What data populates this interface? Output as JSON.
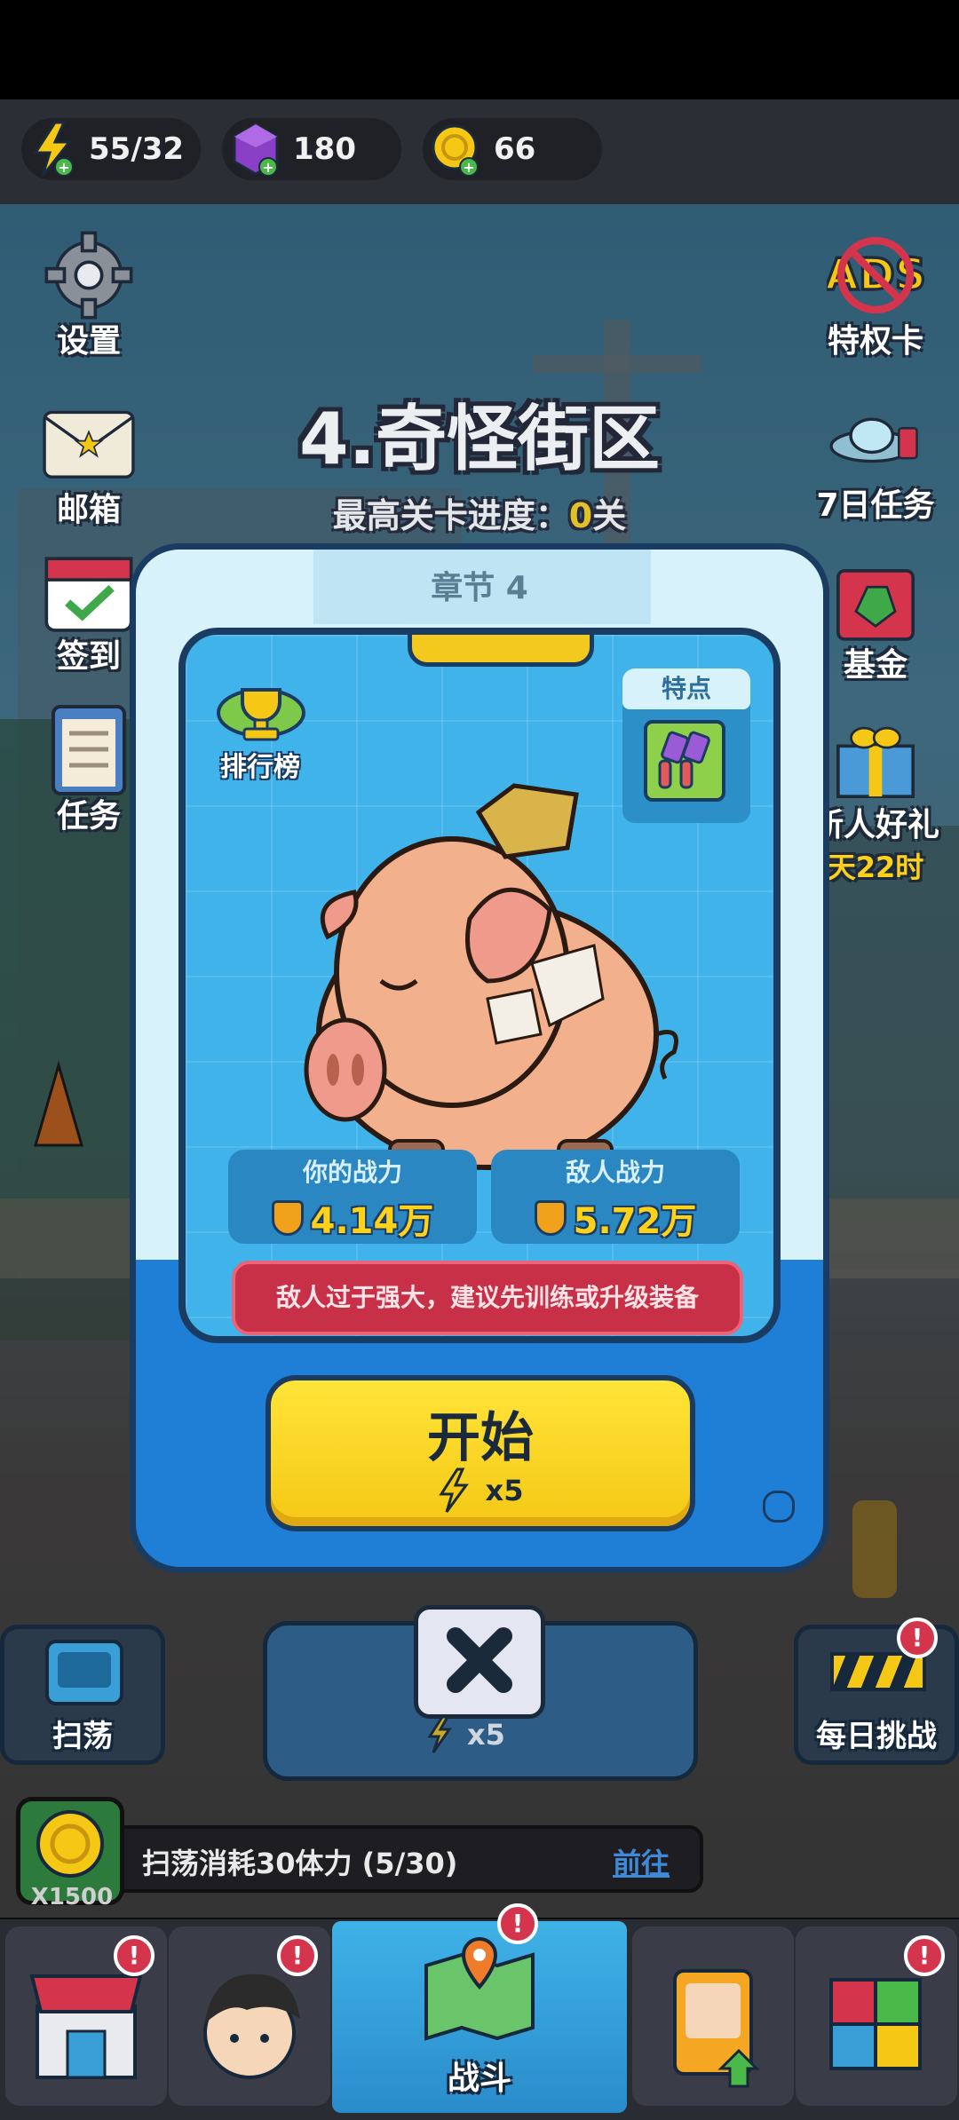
{
  "resources": {
    "energy": "55/32",
    "gems": "180",
    "coins": "66"
  },
  "side_left": [
    {
      "label": "设置"
    },
    {
      "label": "邮箱"
    },
    {
      "label": "签到"
    },
    {
      "label": "任务"
    }
  ],
  "side_right": [
    {
      "label": "特权卡"
    },
    {
      "label": "7日任务"
    },
    {
      "label": "基金"
    },
    {
      "label": "新人好礼",
      "sub": "天22时"
    }
  ],
  "stage": {
    "title": "4.奇怪街区",
    "progress_prefix": "最高关卡进度：",
    "progress_value": "0",
    "progress_suffix": "关"
  },
  "modal": {
    "chapter": "章节 4",
    "leaderboard": "排行榜",
    "feature_label": "特点",
    "my_power_label": "你的战力",
    "my_power": "4.14万",
    "enemy_power_label": "敌人战力",
    "enemy_power": "5.72万",
    "warning": "敌人过于强大，建议先训练或升级装备",
    "start_label": "开始",
    "start_cost": "x5"
  },
  "close": {
    "cost": "x5"
  },
  "sweep": {
    "label": "扫荡"
  },
  "daily": {
    "label": "每日挑战"
  },
  "sweep_info": {
    "text": "扫荡消耗30体力 (5/30)",
    "go": "前往",
    "coin_count": "X1500"
  },
  "nav": {
    "active_label": "战斗",
    "badge": "!"
  },
  "colors": {
    "accent_yellow": "#ffd21a",
    "panel_blue": "#3fb3ea",
    "warn_red": "#c73046"
  }
}
